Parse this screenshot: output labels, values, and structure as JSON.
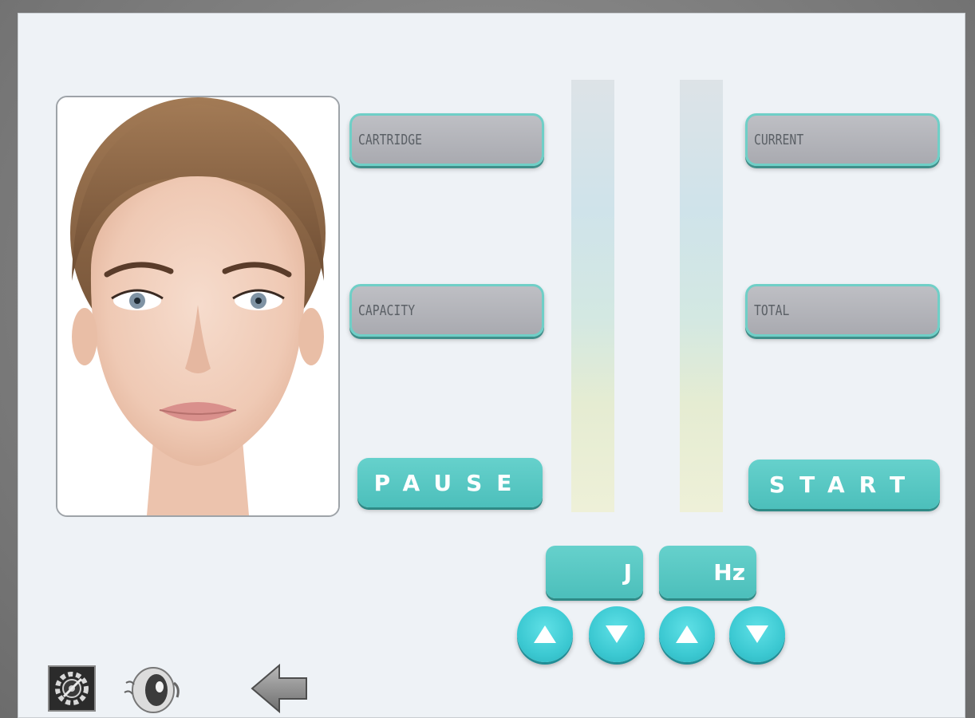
{
  "fields": {
    "cartridge_label": "CARTRIDGE",
    "capacity_label": "CAPACITY",
    "current_label": "CURRENT",
    "total_label": "TOTAL"
  },
  "buttons": {
    "pause_label": "PAUSE",
    "start_label": "START"
  },
  "units": {
    "energy_unit": "J",
    "frequency_unit": "Hz"
  },
  "icons": {
    "settings": "settings-gear-icon",
    "view": "eye-icon",
    "back": "back-arrow-icon",
    "up": "triangle-up-icon",
    "down": "triangle-down-icon"
  },
  "colors": {
    "accent_teal": "#4cbfbb",
    "arrow_cyan": "#3cc9d2",
    "field_gray": "#b3b4b9",
    "screen_bg": "#eef2f6"
  }
}
